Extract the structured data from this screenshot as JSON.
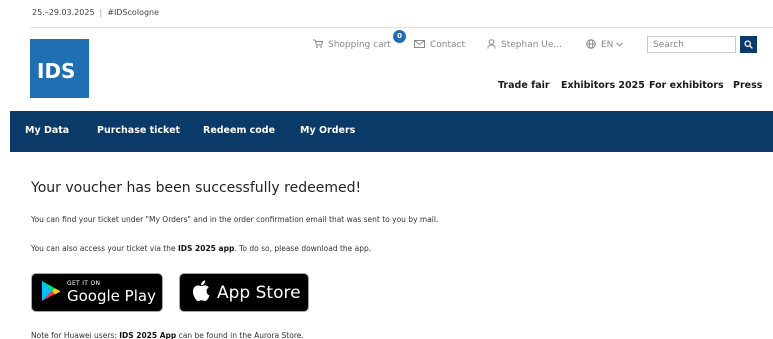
{
  "topbar": {
    "dates": "25.–29.03.2025",
    "separator": "|",
    "hashtag": "#IDScologne"
  },
  "logo": {
    "text": "IDS"
  },
  "utility": {
    "cart_label": "Shopping cart",
    "cart_count": "0",
    "contact_label": "Contact",
    "user_label": "Stephan Ue...",
    "language": "EN",
    "search_placeholder": "Search"
  },
  "main_nav": [
    {
      "label": "Trade fair"
    },
    {
      "label": "Exhibitors 2025"
    },
    {
      "label": "For exhibitors"
    },
    {
      "label": "Press"
    }
  ],
  "sub_nav": [
    {
      "label": "My Data"
    },
    {
      "label": "Purchase ticket"
    },
    {
      "label": "Redeem code"
    },
    {
      "label": "My Orders"
    }
  ],
  "content": {
    "headline": "Your voucher has been successfully redeemed!",
    "paragraph1": "You can find your ticket under \"My Orders\" and in the order confirmation email that was sent to you by mail.",
    "paragraph2_pre": "You can also access your ticket via the ",
    "paragraph2_bold": "IDS 2025 app",
    "paragraph2_post": ". To do so, please download the app.",
    "google_play_small": "GET IT ON",
    "google_play_big": "Google Play",
    "app_store_big": "App Store",
    "note_pre": "Note for Huawei users: ",
    "note_bold": "IDS 2025 App",
    "note_post": " can be found in the Aurora Store."
  },
  "colors": {
    "brand_blue": "#1f6fb2",
    "nav_dark_blue": "#0a3a68"
  }
}
